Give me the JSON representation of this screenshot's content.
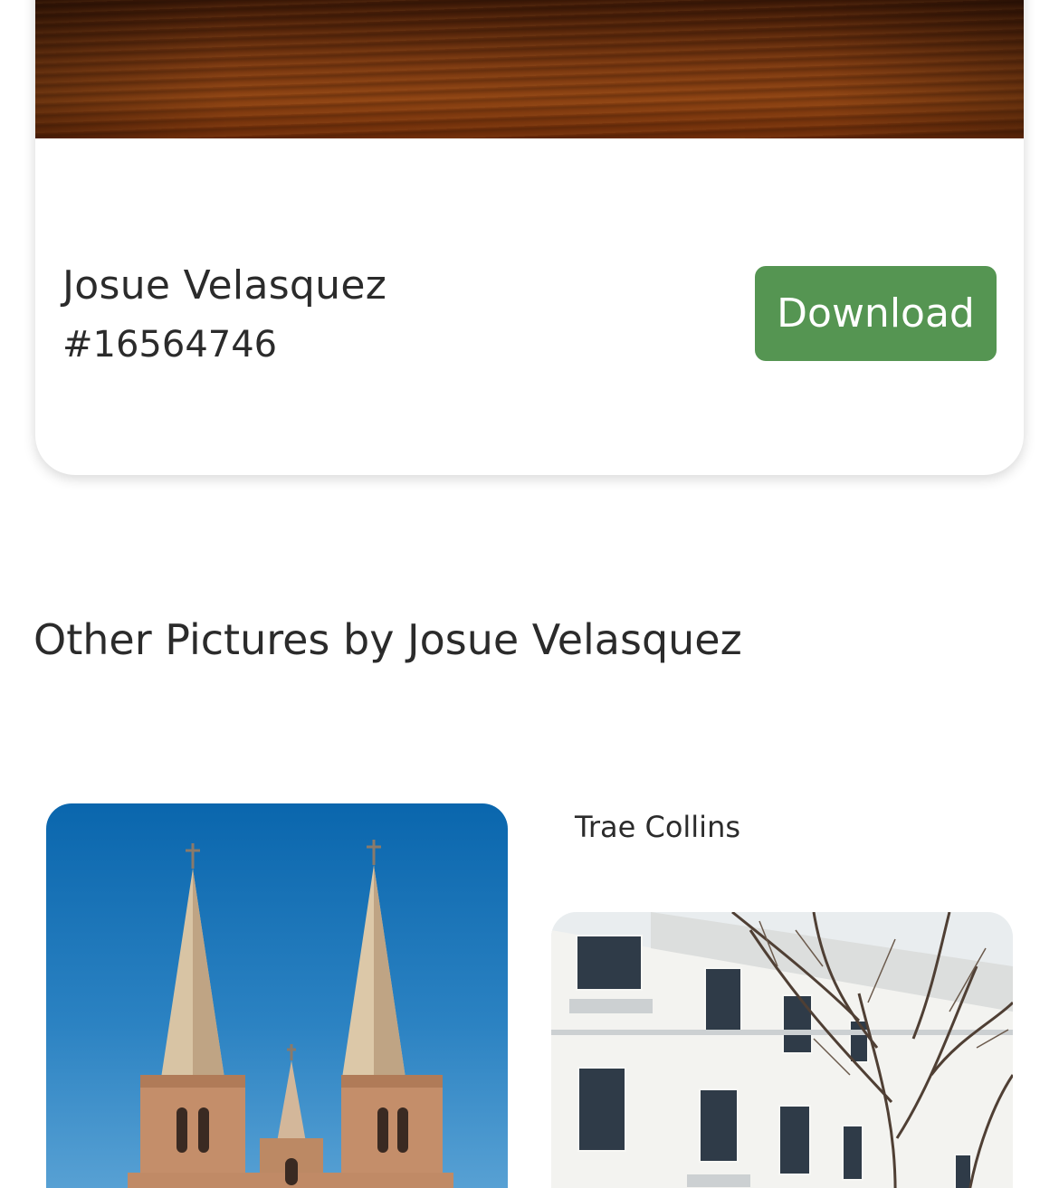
{
  "photo": {
    "author": "Josue Velasquez",
    "id": "#16564746",
    "download_label": "Download"
  },
  "section": {
    "title": "Other Pictures by Josue Velasquez"
  },
  "gallery": {
    "items": [
      {
        "subject": "cathedral-spires"
      },
      {
        "caption": "Trae Collins",
        "subject": "white-building-with-bare-tree"
      }
    ]
  },
  "colors": {
    "download_button": "#559552",
    "text": "#2b2b2b"
  }
}
